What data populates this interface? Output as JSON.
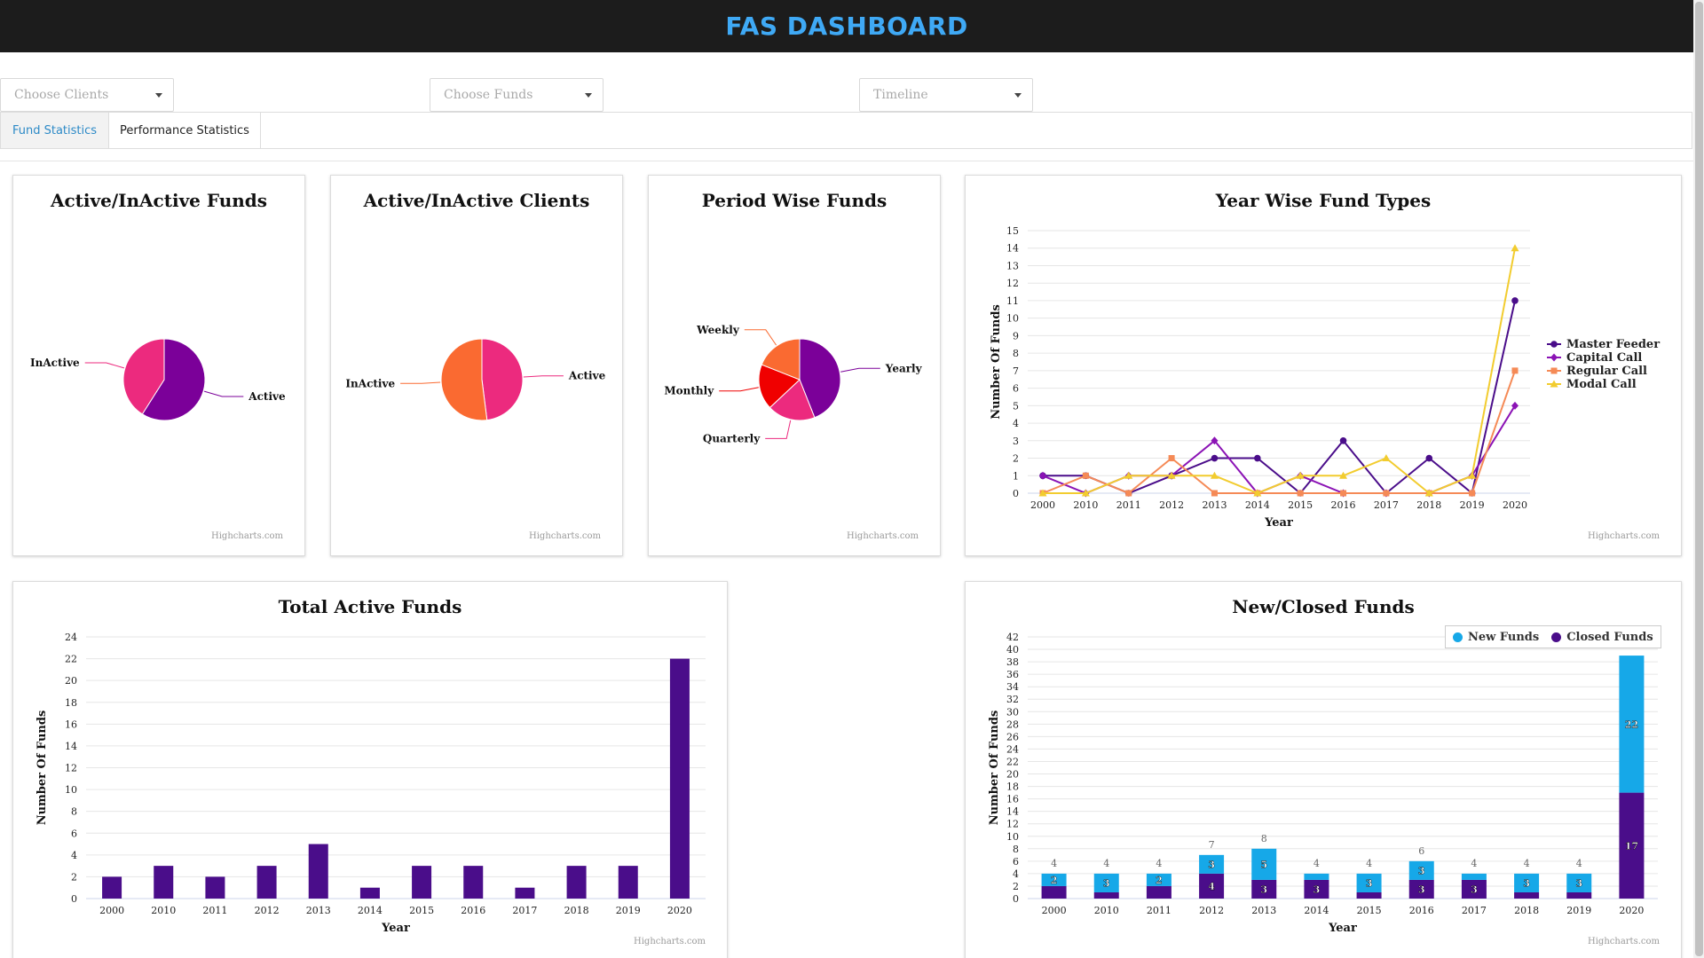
{
  "header": {
    "title": "FAS DASHBOARD"
  },
  "filters": {
    "clients_placeholder": "Choose Clients",
    "funds_placeholder": "Choose Funds",
    "timeline_placeholder": "Timeline"
  },
  "tabs": [
    {
      "label": "Fund Statistics",
      "active": true
    },
    {
      "label": "Performance Statistics",
      "active": false
    }
  ],
  "credits": "Highcharts.com",
  "colors": {
    "purple": "#7b0099",
    "pink": "#ec2a7e",
    "orange": "#fa6a31",
    "red": "#f00000",
    "indigo": "#4a0d8a",
    "cyan": "#16a8e8",
    "yellow": "#f2cc2f",
    "salmon": "#f58a56",
    "magenta": "#8b13b5"
  },
  "chart_data": [
    {
      "id": "active_inactive_funds",
      "type": "pie",
      "title": "Active/InActive Funds",
      "slices": [
        {
          "name": "Active",
          "value": 59,
          "color": "#7b0099"
        },
        {
          "name": "InActive",
          "value": 41,
          "color": "#ec2a7e"
        }
      ]
    },
    {
      "id": "active_inactive_clients",
      "type": "pie",
      "title": "Active/InActive Clients",
      "slices": [
        {
          "name": "Active",
          "value": 48,
          "color": "#ec2a7e"
        },
        {
          "name": "InActive",
          "value": 52,
          "color": "#fa6a31"
        }
      ]
    },
    {
      "id": "period_wise_funds",
      "type": "pie",
      "title": "Period Wise Funds",
      "slices": [
        {
          "name": "Yearly",
          "value": 44,
          "color": "#7b0099"
        },
        {
          "name": "Quarterly",
          "value": 19,
          "color": "#ec2a7e"
        },
        {
          "name": "Monthly",
          "value": 18,
          "color": "#f00000"
        },
        {
          "name": "Weekly",
          "value": 19,
          "color": "#fa6a31"
        }
      ]
    },
    {
      "id": "year_wise_fund_types",
      "type": "line",
      "title": "Year Wise Fund Types",
      "xlabel": "Year",
      "ylabel": "Number Of Funds",
      "ylim": [
        0,
        15
      ],
      "categories": [
        "2000",
        "2010",
        "2011",
        "2012",
        "2013",
        "2014",
        "2015",
        "2016",
        "2017",
        "2018",
        "2019",
        "2020"
      ],
      "series": [
        {
          "name": "Master Feeder",
          "color": "#4a0d8a",
          "marker": "circle",
          "values": [
            1,
            1,
            0,
            1,
            2,
            2,
            0,
            3,
            0,
            2,
            0,
            11
          ]
        },
        {
          "name": "Capital Call",
          "color": "#8b13b5",
          "marker": "diamond",
          "values": [
            1,
            0,
            1,
            1,
            3,
            0,
            1,
            0,
            0,
            0,
            1,
            5
          ]
        },
        {
          "name": "Regular Call",
          "color": "#f58a56",
          "marker": "square",
          "values": [
            0,
            1,
            0,
            2,
            0,
            0,
            0,
            0,
            0,
            0,
            0,
            7
          ]
        },
        {
          "name": "Modal Call",
          "color": "#f2cc2f",
          "marker": "triangle",
          "values": [
            0,
            0,
            1,
            1,
            1,
            0,
            1,
            1,
            2,
            0,
            1,
            14
          ]
        }
      ],
      "legend": "right"
    },
    {
      "id": "total_active_funds",
      "type": "bar",
      "title": "Total Active Funds",
      "xlabel": "Year",
      "ylabel": "Number Of Funds",
      "ylim": [
        0,
        24
      ],
      "categories": [
        "2000",
        "2010",
        "2011",
        "2012",
        "2013",
        "2014",
        "2015",
        "2016",
        "2017",
        "2018",
        "2019",
        "2020"
      ],
      "values": [
        2,
        3,
        2,
        3,
        5,
        1,
        3,
        3,
        1,
        3,
        3,
        22
      ],
      "color": "#4a0d8a"
    },
    {
      "id": "new_closed_funds",
      "type": "bar",
      "stacked": true,
      "title": "New/Closed Funds",
      "xlabel": "Year",
      "ylabel": "Number Of Funds",
      "ylim": [
        0,
        42
      ],
      "categories": [
        "2000",
        "2010",
        "2011",
        "2012",
        "2013",
        "2014",
        "2015",
        "2016",
        "2017",
        "2018",
        "2019",
        "2020"
      ],
      "series": [
        {
          "name": "New Funds",
          "color": "#16a8e8",
          "values": [
            2,
            3,
            2,
            3,
            5,
            1,
            3,
            3,
            1,
            3,
            3,
            22
          ]
        },
        {
          "name": "Closed Funds",
          "color": "#4a0d8a",
          "values": [
            2,
            1,
            2,
            4,
            3,
            3,
            1,
            3,
            3,
            1,
            1,
            17
          ]
        }
      ],
      "totals": [
        "4",
        "4",
        "4",
        "7",
        "8",
        "4",
        "4",
        "6",
        "4",
        "4",
        "4",
        ""
      ],
      "segment_labels": {
        "new": [
          "2",
          "3",
          "2",
          "3",
          "5",
          "",
          "3",
          "3",
          "",
          "3",
          "3",
          "22"
        ],
        "closed": [
          "",
          "",
          "",
          "4",
          "3",
          "3",
          "",
          "3",
          "3",
          "",
          "",
          "17"
        ]
      },
      "legend": "top-right"
    }
  ]
}
